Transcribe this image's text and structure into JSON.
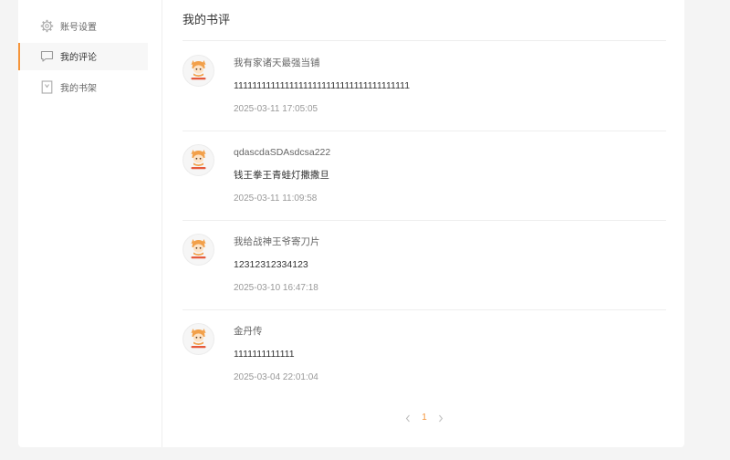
{
  "colors": {
    "accent": "#f5953a",
    "page_background": "#f4f4f4",
    "card_background": "#ffffff",
    "divider": "#eeeeee",
    "active_background": "#f7f7f7",
    "text_primary": "#333333",
    "text_secondary": "#666666",
    "text_muted": "#999999"
  },
  "sidebar": {
    "items": [
      {
        "label": "账号设置",
        "icon": "gear-icon",
        "active": false
      },
      {
        "label": "我的评论",
        "icon": "comment-icon",
        "active": true
      },
      {
        "label": "我的书架",
        "icon": "bookmark-icon",
        "active": false
      }
    ]
  },
  "main": {
    "title": "我的书评",
    "comments": [
      {
        "book_title": "我有家诸天最强当铺",
        "content": "11111111111111111111111111111111111111",
        "time": "2025-03-11 17:05:05"
      },
      {
        "book_title": "qdascdaSDAsdcsa222",
        "content": "钱王拳王青蛙灯撒撒旦",
        "time": "2025-03-11 11:09:58"
      },
      {
        "book_title": "我给战神王爷寄刀片",
        "content": "12312312334123",
        "time": "2025-03-10 16:47:18"
      },
      {
        "book_title": "金丹传",
        "content": "1111111111111",
        "time": "2025-03-04 22:01:04"
      }
    ]
  },
  "pagination": {
    "prev_icon": "chevron-left-icon",
    "current_page": "1",
    "next_icon": "chevron-right-icon"
  }
}
